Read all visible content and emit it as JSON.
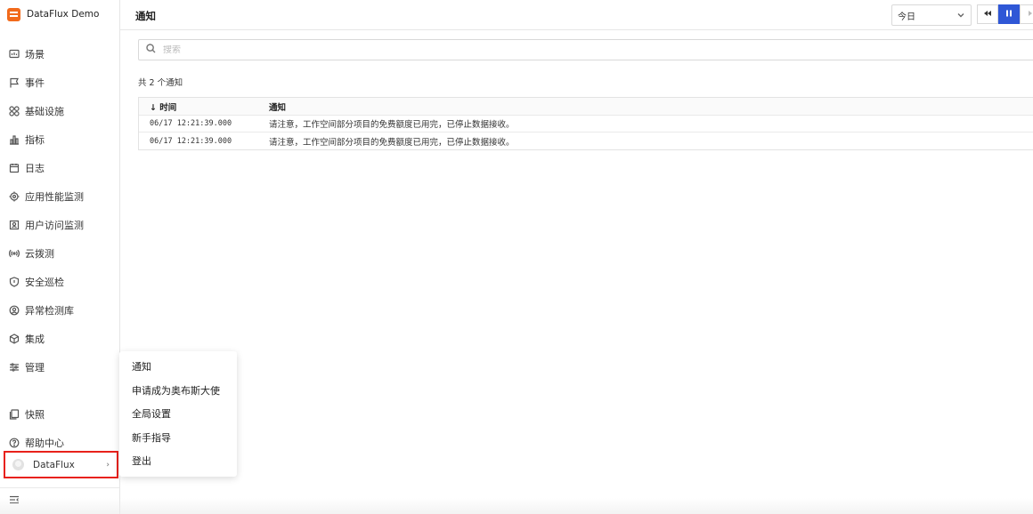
{
  "app": {
    "name": "DataFlux Demo",
    "brand_color": "#f26a1b"
  },
  "sidebar": {
    "items": [
      {
        "label": "场景",
        "icon": "dashboard-icon"
      },
      {
        "label": "事件",
        "icon": "flag-icon"
      },
      {
        "label": "基础设施",
        "icon": "infrastructure-icon"
      },
      {
        "label": "指标",
        "icon": "bar-chart-icon"
      },
      {
        "label": "日志",
        "icon": "calendar-icon"
      },
      {
        "label": "应用性能监测",
        "icon": "target-icon"
      },
      {
        "label": "用户访问监测",
        "icon": "user-monitor-icon"
      },
      {
        "label": "云拨测",
        "icon": "signal-icon"
      },
      {
        "label": "安全巡检",
        "icon": "shield-icon"
      },
      {
        "label": "异常检测库",
        "icon": "detector-icon"
      },
      {
        "label": "集成",
        "icon": "cube-icon"
      },
      {
        "label": "管理",
        "icon": "settings-sliders-icon"
      }
    ],
    "bottom_items": [
      {
        "label": "快照",
        "icon": "snapshot-icon"
      },
      {
        "label": "帮助中心",
        "icon": "help-icon"
      }
    ],
    "user": {
      "name": "DataFlux"
    }
  },
  "header": {
    "title": "通知",
    "time_range": "今日"
  },
  "search": {
    "placeholder": "搜索"
  },
  "summary": {
    "count_text": "共 2 个通知"
  },
  "table": {
    "columns": [
      "↓ 时间",
      "通知"
    ],
    "rows": [
      {
        "time": "06/17 12:21:39.000",
        "message": "请注意，工作空间部分项目的免费额度已用完，已停止数据接收。"
      },
      {
        "time": "06/17 12:21:39.000",
        "message": "请注意，工作空间部分项目的免费额度已用完，已停止数据接收。"
      }
    ]
  },
  "user_menu": {
    "items": [
      "通知",
      "申请成为奥布斯大使",
      "全局设置",
      "新手指导",
      "登出"
    ]
  },
  "colors": {
    "accent": "#2f57d6",
    "highlight_border": "#e8211a"
  }
}
